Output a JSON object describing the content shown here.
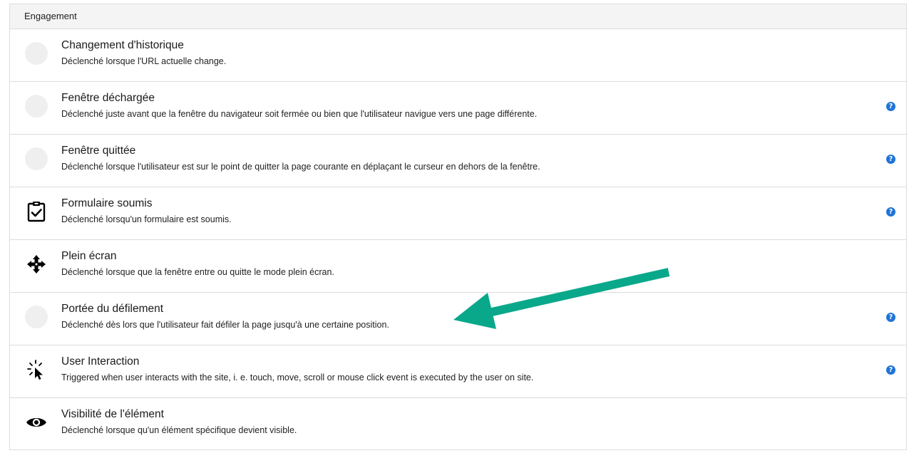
{
  "section": {
    "title": "Engagement"
  },
  "help_glyph": "?",
  "accent_colors": {
    "help": "#1f74d8",
    "arrow": "#0aa88b"
  },
  "items": [
    {
      "title": "Changement d'historique",
      "description": "Déclenché lorsque l'URL actuelle change.",
      "icon": "placeholder-circle",
      "help": false
    },
    {
      "title": "Fenêtre déchargée",
      "description": "Déclenché juste avant que la fenêtre du navigateur soit fermée ou bien que l'utilisateur navigue vers une page différente.",
      "icon": "placeholder-circle",
      "help": true
    },
    {
      "title": "Fenêtre quittée",
      "description": "Déclenché lorsque l'utilisateur est sur le point de quitter la page courante en déplaçant le curseur en dehors de la fenêtre.",
      "icon": "placeholder-circle",
      "help": true
    },
    {
      "title": "Formulaire soumis",
      "description": "Déclenché lorsqu'un formulaire est soumis.",
      "icon": "clipboard-check-icon",
      "help": true
    },
    {
      "title": "Plein écran",
      "description": "Déclenché lorsque que la fenêtre entre ou quitte le mode plein écran.",
      "icon": "move-arrows-icon",
      "help": false
    },
    {
      "title": "Portée du défilement",
      "description": "Déclenché dès lors que l'utilisateur fait défiler la page jusqu'à une certaine position.",
      "icon": "placeholder-circle",
      "help": true
    },
    {
      "title": "User Interaction",
      "description": "Triggered when user interacts with the site, i. e. touch, move, scroll or mouse click event is executed by the user on site.",
      "icon": "cursor-click-icon",
      "help": true
    },
    {
      "title": "Visibilité de l'élément",
      "description": "Déclenché lorsque qu'un élément spécifique devient visible.",
      "icon": "eye-icon",
      "help": false
    }
  ]
}
